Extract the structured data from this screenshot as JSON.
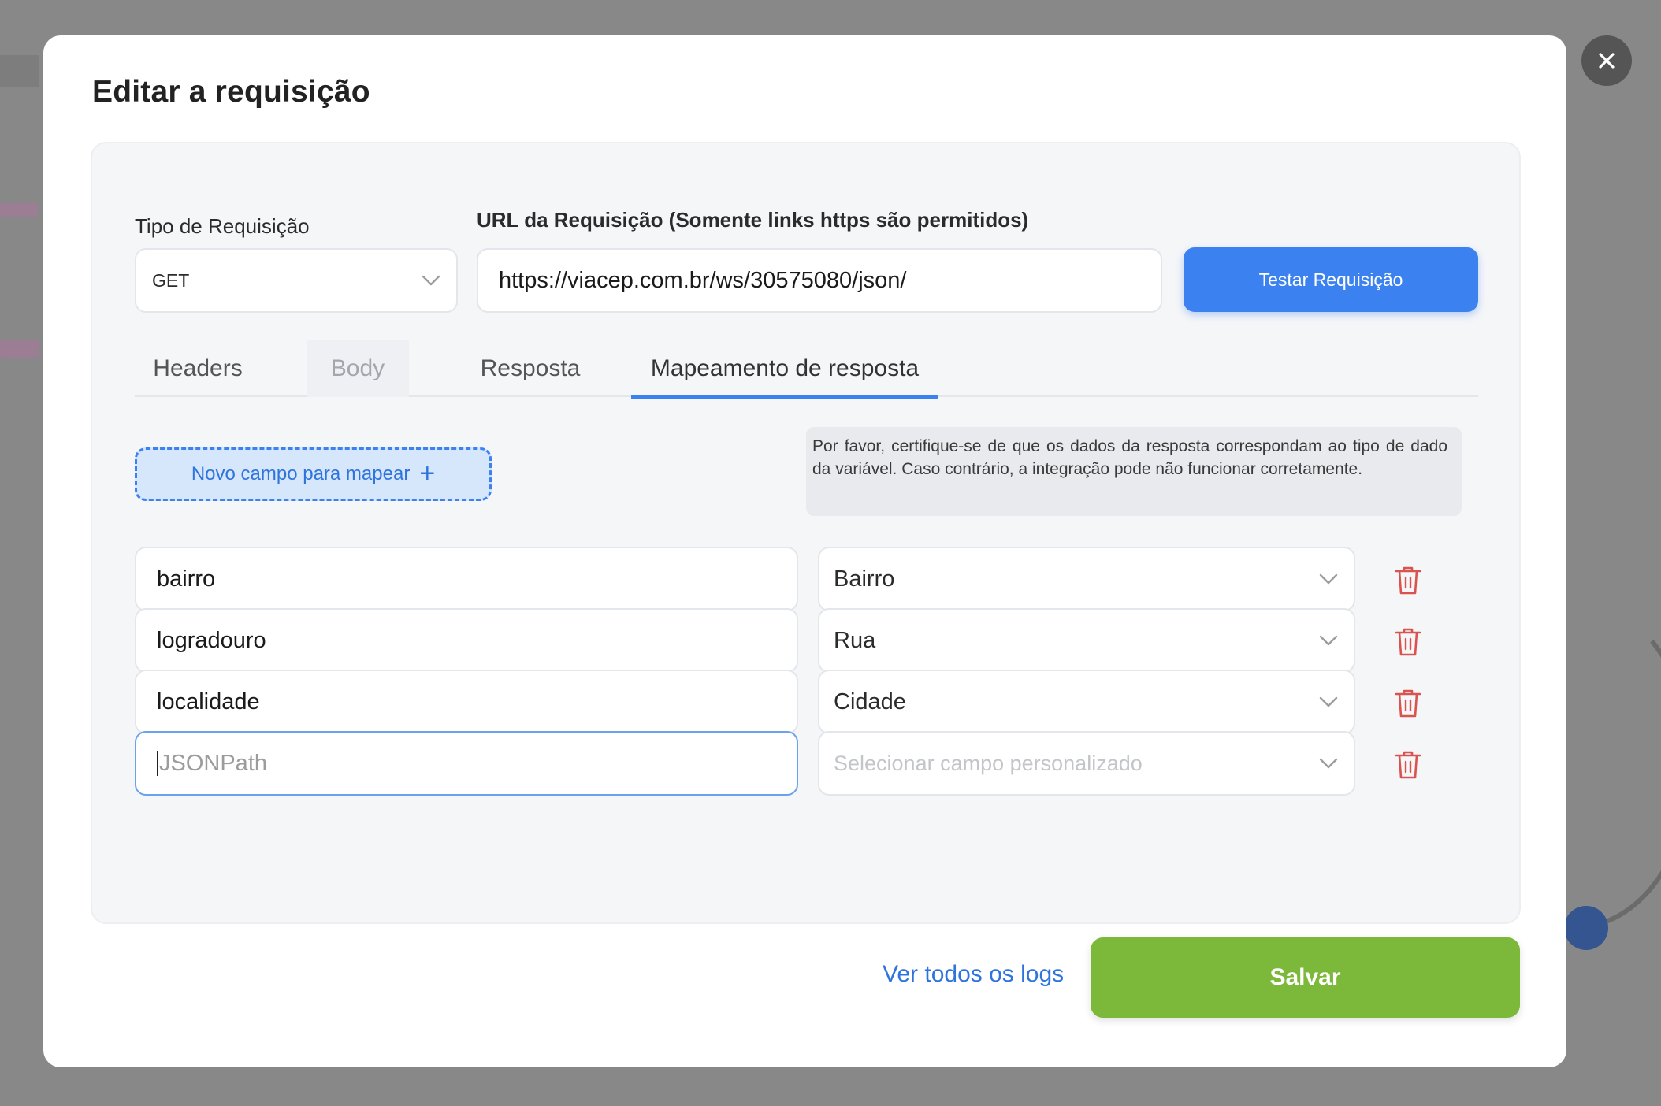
{
  "modal": {
    "title": "Editar a requisição",
    "close_icon": "close-icon"
  },
  "request": {
    "type_label": "Tipo de Requisição",
    "type_value": "GET",
    "url_label": "URL da Requisição (Somente links https são permitidos)",
    "url_value": "https://viacep.com.br/ws/30575080/json/",
    "test_button": "Testar Requisição"
  },
  "tabs": [
    {
      "label": "Headers",
      "state": "default"
    },
    {
      "label": "Body",
      "state": "disabled"
    },
    {
      "label": "Resposta",
      "state": "default"
    },
    {
      "label": "Mapeamento de resposta",
      "state": "active"
    }
  ],
  "mapping": {
    "new_field_button": "Novo campo para mapear",
    "new_field_icon": "plus-icon",
    "notice": "Por favor, certifique-se de que os dados da resposta correspondam ao tipo de dado da variável. Caso contrário, a integração pode não funcionar corretamente.",
    "rows": [
      {
        "json_path": "bairro",
        "field": "Bairro"
      },
      {
        "json_path": "logradouro",
        "field": "Rua"
      },
      {
        "json_path": "localidade",
        "field": "Cidade"
      },
      {
        "json_path": "",
        "field": ""
      }
    ],
    "json_placeholder": "JSONPath",
    "field_placeholder": "Selecionar campo personalizado"
  },
  "footer": {
    "logs_link": "Ver todos os logs",
    "save_button": "Salvar"
  },
  "colors": {
    "primary": "#3b82f0",
    "save": "#7cb93a",
    "delete": "#d9534f"
  }
}
